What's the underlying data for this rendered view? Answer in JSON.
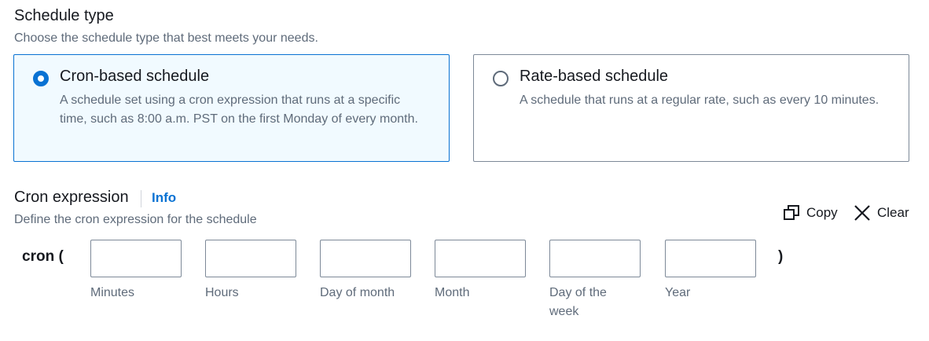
{
  "schedule_type": {
    "title": "Schedule type",
    "description": "Choose the schedule type that best meets your needs.",
    "options": [
      {
        "label": "Cron-based schedule",
        "description": "A schedule set using a cron expression that runs at a specific time, such as 8:00 a.m. PST on the first Monday of every month.",
        "selected": true
      },
      {
        "label": "Rate-based schedule",
        "description": "A schedule that runs at a regular rate, such as every 10 minutes.",
        "selected": false
      }
    ]
  },
  "cron_expression": {
    "title": "Cron expression",
    "info_label": "Info",
    "description": "Define the cron expression for the schedule",
    "copy_label": "Copy",
    "clear_label": "Clear",
    "prefix": "cron (",
    "suffix": ")",
    "fields": [
      {
        "label": "Minutes",
        "value": ""
      },
      {
        "label": "Hours",
        "value": ""
      },
      {
        "label": "Day of month",
        "value": ""
      },
      {
        "label": "Month",
        "value": ""
      },
      {
        "label": "Day of the week",
        "value": ""
      },
      {
        "label": "Year",
        "value": ""
      }
    ]
  },
  "colors": {
    "accent": "#0972d3",
    "selected_bg": "#f1faff",
    "border": "#7d8998",
    "secondary_text": "#5f6b7a"
  },
  "icons": {
    "copy": "copy-icon",
    "clear": "close-icon"
  }
}
